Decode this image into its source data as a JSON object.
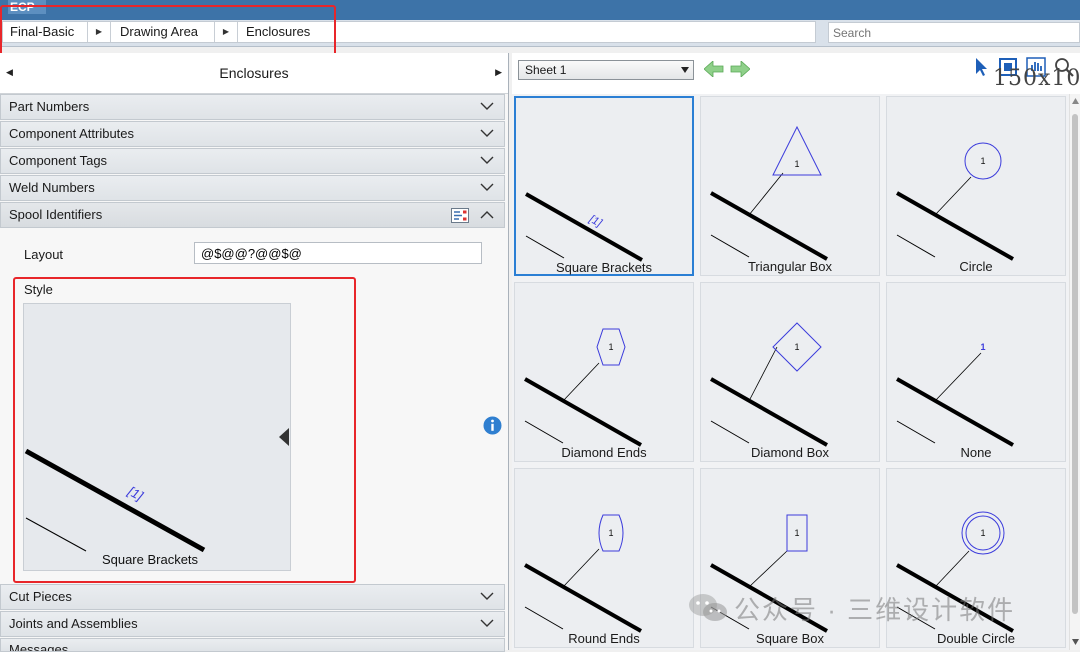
{
  "app": {
    "logo_text": "ECP"
  },
  "breadcrumb": {
    "items": [
      {
        "label": "Final-Basic"
      },
      {
        "label": "Drawing Area"
      },
      {
        "label": "Enclosures"
      }
    ]
  },
  "search": {
    "placeholder": "Search"
  },
  "left_panel": {
    "title": "Enclosures",
    "sections_top": [
      {
        "label": "Part Numbers"
      },
      {
        "label": "Component Attributes"
      },
      {
        "label": "Component Tags"
      },
      {
        "label": "Weld Numbers"
      },
      {
        "label": "Spool Identifiers"
      }
    ],
    "layout": {
      "label": "Layout",
      "value": "@$@@?@@$@"
    },
    "style": {
      "label": "Style",
      "preview_caption": "Square Brackets",
      "preview_tag": "[1]"
    },
    "sections_bottom": [
      {
        "label": "Cut Pieces"
      },
      {
        "label": "Joints and Assemblies"
      },
      {
        "label": "Messages"
      }
    ]
  },
  "right_panel": {
    "sheet": {
      "selected": "Sheet 1"
    },
    "overlay_text": "150x10",
    "tiles": [
      {
        "label": "Square Brackets",
        "tag": "[1]",
        "shape": "brackets",
        "selected": true
      },
      {
        "label": "Triangular Box",
        "tag": "1",
        "shape": "triangle"
      },
      {
        "label": "Circle",
        "tag": "1",
        "shape": "circle"
      },
      {
        "label": "Diamond Ends",
        "tag": "1",
        "shape": "hexagon"
      },
      {
        "label": "Diamond Box",
        "tag": "1",
        "shape": "diamond"
      },
      {
        "label": "None",
        "tag": "1",
        "shape": "none"
      },
      {
        "label": "Round Ends",
        "tag": "1",
        "shape": "roundends"
      },
      {
        "label": "Square Box",
        "tag": "1",
        "shape": "rect"
      },
      {
        "label": "Double Circle",
        "tag": "1",
        "shape": "doublecircle"
      }
    ]
  },
  "colors": {
    "accent": "#2b7fd4",
    "highlight": "#e8262a",
    "symbol": "#3b3bdc",
    "header": "#3d73a8"
  },
  "watermark": {
    "text": "公众号 · 三维设计软件"
  }
}
